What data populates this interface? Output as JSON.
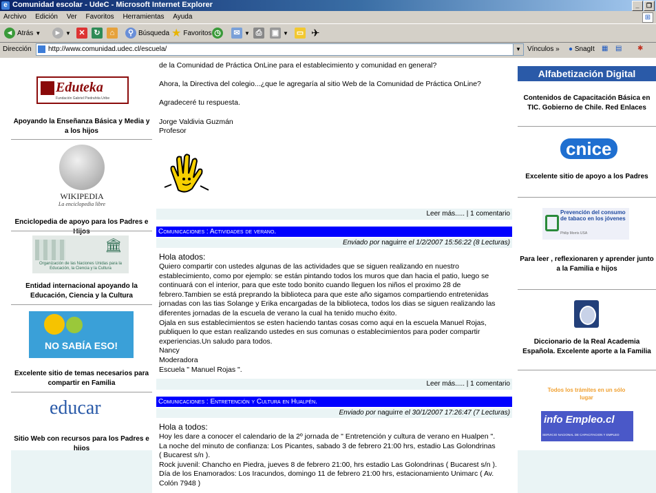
{
  "window": {
    "title": "Comunidad escolar - UdeC - Microsoft Internet Explorer"
  },
  "menu": [
    "Archivo",
    "Edición",
    "Ver",
    "Favoritos",
    "Herramientas",
    "Ayuda"
  ],
  "toolbar": {
    "back_label": "Atrás",
    "search_label": "Búsqueda",
    "favorites_label": "Favoritos"
  },
  "address": {
    "label": "Dirección",
    "url": "http://www.comunidad.udec.cl/escuela/",
    "links_label": "Vínculos",
    "snagit_label": "SnagIt"
  },
  "left_sidebar": {
    "items": [
      {
        "logo_text": "Eduteka",
        "logo_subtext": "Fundación Gabriel Piedrahita Uribe",
        "caption": "Apoyando la Enseñanza Básica y Media y a los hijos"
      },
      {
        "logo_text": "WIKIPEDIA",
        "logo_subtext": "La enciclopedia libre",
        "caption": "Enciclopedia de apoyo para los Padres e Hijos"
      },
      {
        "logo_text": "Organización de las Naciones Unidas para la Educación, la Ciencia y la Cultura",
        "caption": "Entidad internacional apoyando la Educación, Ciencia y la Cultura"
      },
      {
        "logo_text": "NO SABÍA ESO!",
        "caption": "Excelente sitio de temas necesarios para compartir en Familia"
      },
      {
        "logo_text": "educar",
        "caption": "Sitio Web con recursos para los Padres e hijos"
      }
    ]
  },
  "posts": [
    {
      "lines": [
        "de la Comunidad de Práctica OnLine para el establecimiento y comunidad en general?",
        "",
        "Ahora, la Directiva del colegio...¿que le agregaría al sitio Web de la Comunidad de Práctica OnLine?",
        "",
        "Agradeceré tu respuesta.",
        "",
        "Jorge Valdivia Guzmán",
        "Profesor"
      ],
      "footer": "Leer más..... | 1 comentario"
    },
    {
      "title": "Comunicaciones : Actividades de verano.",
      "meta_prefix": "Enviado por",
      "author": "naguirre",
      "meta_suffix": "el 1/2/2007 15:56:22 (8 Lecturas)",
      "lines": [
        "Hola atodos:",
        "Quiero compartir con ustedes algunas de las actividades que se siguen realizando en nuestro",
        "establecimiento, como por ejemplo: se están pintando todos los muros que dan hacia el patio, luego se",
        "continuará con el interior, para que este todo bonito cuando lleguen los niños el proximo 28 de",
        "febrero.Tambien se está preprando la biblioteca para que este año sigamos compartiendo entretenidas",
        "jornadas con las tias Solange y Erika encargadas de la biblioteca, todos los dias se siguen realizando las",
        "diferentes jornadas de la escuela de verano la cual ha tenido mucho éxito.",
        "Ojala en sus establecimientos se esten haciendo tantas cosas como aqui en la escuela Manuel Rojas,",
        "publiquen lo que estan realizando ustedes en sus comunas o establecimientos para poder compartir",
        "experiencias.Un saludo para todos.",
        "Nancy",
        "Moderadora",
        "Escuela \" Manuel Rojas \"."
      ],
      "footer": "Leer más..... | 1 comentario"
    },
    {
      "title": "Comunicaciones : Entretención y Cultura en Hualpén.",
      "meta_prefix": "Enviado por",
      "author": "naguirre",
      "meta_suffix": "el 30/1/2007 17:26:47 (7 Lecturas)",
      "lines": [
        "Hola a todos:",
        "Hoy les dare a conocer el calendario de la 2º jornada de \" Entretención y cultura de verano en Hualpen \".",
        "La noche del minuto de confianza: Los Picantes, sabado 3 de febrero 21:00 hrs, estadio Las Golondrinas",
        "( Bucarest s/n ).",
        "Rock juvenil: Chancho en Piedra, jueves 8 de febrero 21:00, hrs estadio Las Golondrinas ( Bucarest s/n ).",
        "Día de los Enamorados: Los Iracundos, domingo 11 de febrero 21:00 hrs, estacionamiento Unimarc ( Av.",
        "Colón 7948 )"
      ]
    }
  ],
  "right_sidebar": {
    "items": [
      {
        "logo_text": "Alfabetización Digital",
        "caption": "Contenidos de Capacitación Básica en TIC. Gobierno de Chile. Red Enlaces"
      },
      {
        "logo_text": "cnice",
        "caption": "Excelente sitio de apoyo a los Padres"
      },
      {
        "logo_text": "Prevención del consumo de tabaco en los jóvenes",
        "logo_subtext": "Philip Morris USA",
        "caption": "Para leer , reflexionaren y aprender junto a la Familia e hijos"
      },
      {
        "caption": "Diccionario de la Real Academia Española. Excelente aporte a la Familia"
      },
      {
        "logo_text": "Todos los trámites en un sólo lugar",
        "logo_text2": "info Empleo.cl",
        "logo_subtext": "SERVICIO NACIONAL DE CAPACITACION Y EMPLEO"
      }
    ]
  },
  "colors": {
    "post_title_bg": "#0000ff",
    "meta_bg": "#eaf4f5",
    "titlebar": "#0a246a"
  }
}
